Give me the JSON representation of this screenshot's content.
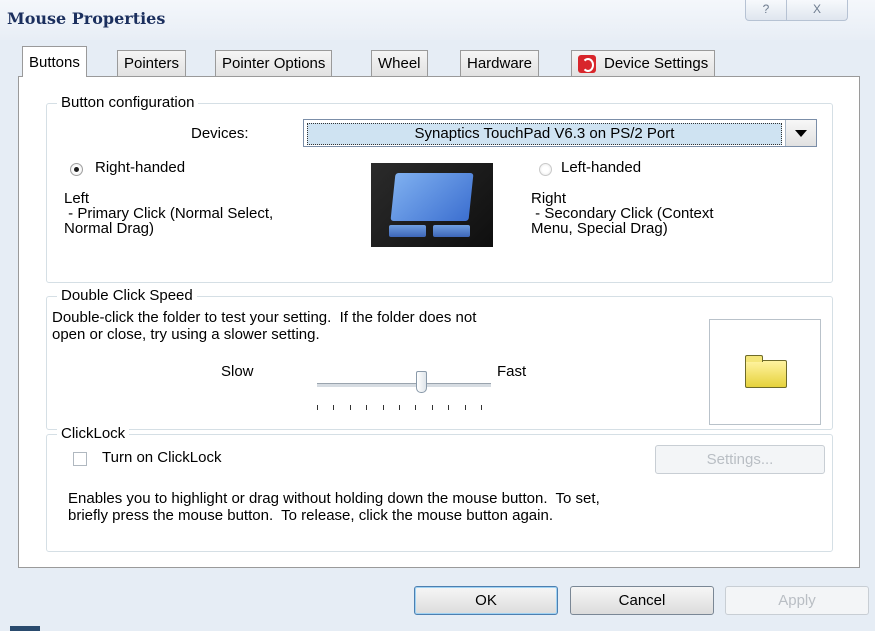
{
  "window": {
    "title": "Mouse Properties",
    "help_glyph": "?",
    "close_glyph": "X"
  },
  "tabs": [
    {
      "label": "Buttons",
      "active": true
    },
    {
      "label": "Pointers"
    },
    {
      "label": "Pointer Options"
    },
    {
      "label": "Wheel"
    },
    {
      "label": "Hardware"
    },
    {
      "label": "Device Settings",
      "icon": "synaptics-icon"
    }
  ],
  "button_config": {
    "group_label": "Button configuration",
    "devices_label": "Devices:",
    "device_value": "Synaptics TouchPad V6.3 on PS/2 Port",
    "right_handed_label": "Right-handed",
    "right_handed_selected": true,
    "left_handed_label": "Left-handed",
    "left_desc": [
      "Left",
      " - Primary Click (Normal Select,",
      "Normal Drag)"
    ],
    "right_desc": [
      "Right",
      " - Secondary Click (Context",
      "Menu, Special Drag)"
    ]
  },
  "double_click": {
    "group_label": "Double Click Speed",
    "instructions": [
      "Double-click the folder to test your setting.  If the folder does not",
      "open or close, try using a slower setting."
    ],
    "slow_label": "Slow",
    "fast_label": "Fast",
    "speed_fraction": 0.6,
    "tick_count": 11
  },
  "clicklock": {
    "group_label": "ClickLock",
    "checkbox_label": "Turn on ClickLock",
    "checked": false,
    "settings_label": "Settings...",
    "description": [
      "Enables you to highlight or drag without holding down the mouse button.  To set,",
      "briefly press the mouse button.  To release, click the mouse button again."
    ]
  },
  "footer": {
    "ok_label": "OK",
    "cancel_label": "Cancel",
    "apply_label": "Apply"
  },
  "colors": {
    "accent_selection": "#cfe3f2",
    "tab_icon": "#d8262b"
  }
}
